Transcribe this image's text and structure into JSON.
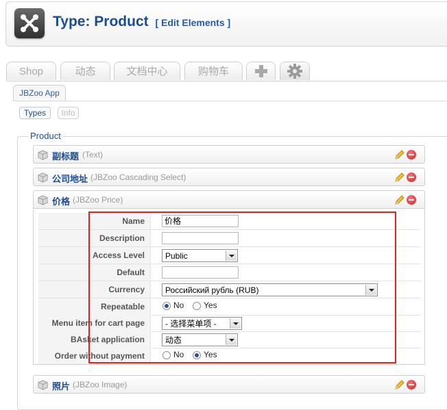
{
  "header": {
    "title": "Type: Product",
    "edit_link": "[ Edit Elements ]",
    "logo_icon": "joomla-logo-icon"
  },
  "tabs": [
    {
      "label": "Shop"
    },
    {
      "label": "动态"
    },
    {
      "label": "文档中心"
    },
    {
      "label": "购物车"
    },
    {
      "label": "+",
      "icon": "plus-icon"
    },
    {
      "label": "",
      "icon": "gear-icon"
    }
  ],
  "subtab": {
    "label": "JBZoo App"
  },
  "pills": {
    "types": "Types",
    "info": "Info"
  },
  "section": {
    "legend": "Product"
  },
  "elements": [
    {
      "name": "副标题",
      "type": "(Text)"
    },
    {
      "name": "公司地址",
      "type": "(JBZoo Cascading Select)"
    },
    {
      "name": "价格",
      "type": "(JBZoo Price)"
    },
    {
      "name": "照片",
      "type": "(JBZoo Image)"
    }
  ],
  "form": {
    "name": {
      "label": "Name",
      "value": "价格"
    },
    "description": {
      "label": "Description",
      "value": ""
    },
    "access_level": {
      "label": "Access Level",
      "value": "Public"
    },
    "default": {
      "label": "Default",
      "value": ""
    },
    "currency": {
      "label": "Currency",
      "value": "Российский рубль (RUB)"
    },
    "repeatable": {
      "label": "Repeatable",
      "no": "No",
      "yes": "Yes",
      "selected": "No"
    },
    "menu_item": {
      "label": "Menu item for cart page",
      "value": "- 选择菜单项 -"
    },
    "basket_app": {
      "label": "BAsket application",
      "value": "动态"
    },
    "order_without_payment": {
      "label": "Order without payment",
      "no": "No",
      "yes": "Yes",
      "selected": "Yes"
    }
  },
  "colors": {
    "accent": "#1a4d94",
    "highlight_box": "#e01f1f",
    "delete": "#d42020"
  }
}
